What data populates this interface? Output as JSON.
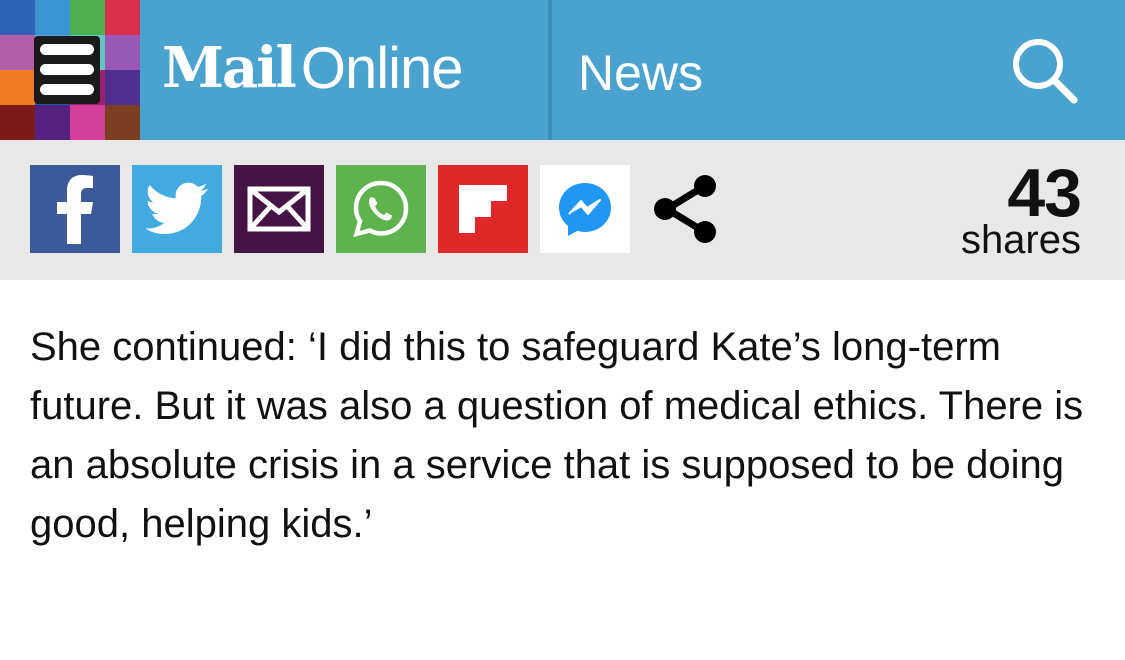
{
  "header": {
    "logo_mail": "Mail",
    "logo_online": "Online",
    "section": "News",
    "background": "#4aa3cf",
    "mosaic_colors": [
      [
        "#2f63b6",
        "#3b95d2",
        "#4caf50",
        "#d9304b"
      ],
      [
        "#b15fa8",
        "#5c9fd6",
        "#62c6c6",
        "#9b59b6"
      ],
      [
        "#ef7b22",
        "#1e5aa8",
        "#a02070",
        "#4f2f8f"
      ],
      [
        "#7a1a1a",
        "#552080",
        "#d23f98",
        "#7d3e21"
      ]
    ],
    "icons": {
      "menu": "hamburger-menu-icon",
      "search": "search-icon"
    }
  },
  "share_bar": {
    "buttons": [
      {
        "name": "facebook",
        "color": "#3b5998",
        "icon": "facebook-icon"
      },
      {
        "name": "twitter",
        "color": "#41abe1",
        "icon": "twitter-icon"
      },
      {
        "name": "email",
        "color": "#451344",
        "icon": "email-icon"
      },
      {
        "name": "whatsapp",
        "color": "#5eb34d",
        "icon": "whatsapp-icon"
      },
      {
        "name": "flipboard",
        "color": "#e12828",
        "icon": "flipboard-icon"
      },
      {
        "name": "messenger",
        "color": "#ffffff",
        "icon": "messenger-icon"
      },
      {
        "name": "more",
        "color": "#000000",
        "icon": "share-icon"
      }
    ],
    "count": "43",
    "count_label": "shares"
  },
  "article": {
    "paragraph": "She continued: ‘I did this to safeguard Kate’s long-term future. But it was also a question of medical ethics. There is an absolute crisis in a service that is supposed to be doing good, helping kids.’"
  }
}
